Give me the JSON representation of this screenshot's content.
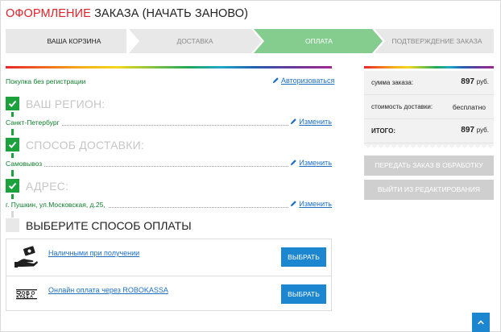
{
  "title": {
    "highlight": "ОФОРМЛЕНИЕ",
    "rest": "ЗАКАЗА (НАЧАТЬ ЗАНОВО)"
  },
  "steps": [
    {
      "label": "ВАША КОРЗИНА",
      "state": "done"
    },
    {
      "label": "ДОСТАВКА",
      "state": "done"
    },
    {
      "label": "ОПЛАТА",
      "state": "active"
    },
    {
      "label": "ПОДТВЕРЖДЕНИЕ ЗАКАЗА",
      "state": "pending"
    }
  ],
  "form": {
    "guest_label": "Покупка без регистрации",
    "login_link": "Авторизоваться",
    "region": {
      "heading": "ВАШ РЕГИОН:",
      "value": "Санкт-Петербург",
      "edit": "Изменить"
    },
    "delivery": {
      "heading": "СПОСОБ ДОСТАВКИ:",
      "value": "Самовывоз",
      "edit": "Изменить"
    },
    "address": {
      "heading": "АДРЕС:",
      "value": "г. Пушкин, ул.Московская, д.25,",
      "edit": "Изменить"
    },
    "payment": {
      "heading": "ВЫБЕРИТЕ СПОСОБ ОПЛАТЫ",
      "methods": [
        {
          "name": "Наличными при получении",
          "button": "ВЫБРАТЬ",
          "icon": "cash-hand-icon"
        },
        {
          "name": "Онлайн оплата через ROBOKASSA",
          "button": "ВЫБРАТЬ",
          "icon": "robokassa-logo"
        }
      ]
    }
  },
  "summary": {
    "order_sum": {
      "label": "сумма заказа:",
      "value": "897",
      "currency": "руб."
    },
    "delivery_cost": {
      "label": "стоимость доставки:",
      "value": "бесплатно"
    },
    "total": {
      "label": "ИТОГО:",
      "value": "897",
      "currency": "руб."
    },
    "submit_button": "ПЕРЕДАТЬ ЗАКАЗ В ОБРАБОТКУ",
    "exit_button": "ВЫЙТИ ИЗ РЕДАКТИРОВАНИЯ"
  },
  "colors": {
    "accent_red": "#e0232a",
    "green": "#1ca23d",
    "link_blue": "#1d6fc2",
    "button_blue": "#1d86d0",
    "step_active": "#85cc8f"
  }
}
